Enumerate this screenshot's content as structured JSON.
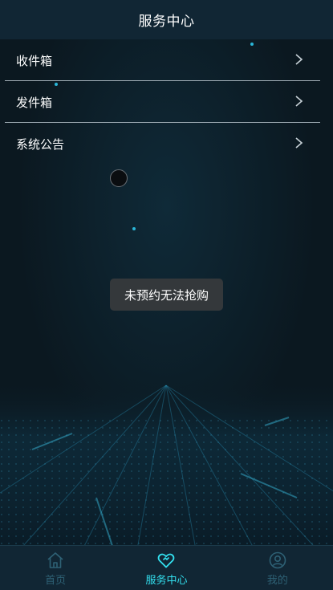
{
  "header": {
    "title": "服务中心"
  },
  "menu": {
    "items": [
      {
        "label": "收件箱"
      },
      {
        "label": "发件箱"
      },
      {
        "label": "系统公告"
      }
    ]
  },
  "toast": {
    "text": "未预约无法抢购"
  },
  "tabbar": {
    "tabs": [
      {
        "label": "首页",
        "icon": "home-icon",
        "active": false
      },
      {
        "label": "服务中心",
        "icon": "heart-icon",
        "active": true
      },
      {
        "label": "我的",
        "icon": "user-icon",
        "active": false
      }
    ]
  },
  "colors": {
    "background": "#0c1a24",
    "bar": "#112634",
    "accent": "#33e1f0",
    "inactive": "#2e6175"
  }
}
